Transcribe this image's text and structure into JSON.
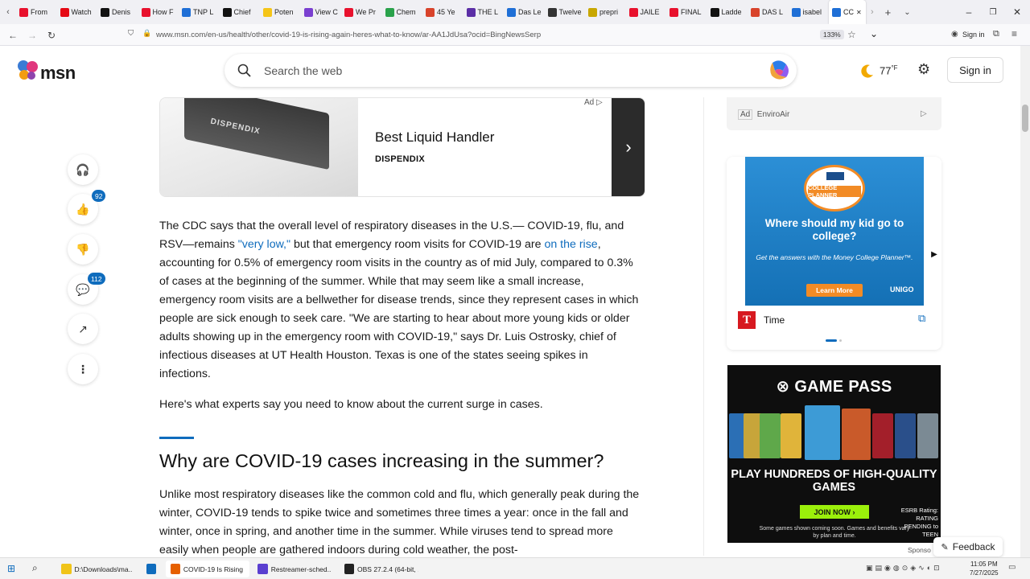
{
  "browser": {
    "tabs": [
      {
        "label": "From",
        "color": "#e8112d"
      },
      {
        "label": "Watch",
        "color": "#e50914"
      },
      {
        "label": "Denis",
        "color": "#111111"
      },
      {
        "label": "How F",
        "color": "#e8112d"
      },
      {
        "label": "TNP L",
        "color": "#1f6fd6"
      },
      {
        "label": "Chief",
        "color": "#111111"
      },
      {
        "label": "Poten",
        "color": "#f5c518"
      },
      {
        "label": "View C",
        "color": "#7a3fd0"
      },
      {
        "label": "We Pr",
        "color": "#e8112d"
      },
      {
        "label": "Chem",
        "color": "#2aa24b"
      },
      {
        "label": "45 Ye",
        "color": "#d8432b"
      },
      {
        "label": "THE L",
        "color": "#5b2ea6"
      },
      {
        "label": "Das Le",
        "color": "#1f6fd6"
      },
      {
        "label": "Twelve",
        "color": "#333333"
      },
      {
        "label": "prepri",
        "color": "#c8a700"
      },
      {
        "label": "JAILE",
        "color": "#e8112d"
      },
      {
        "label": "FINAL",
        "color": "#e8112d"
      },
      {
        "label": "Ladde",
        "color": "#111111"
      },
      {
        "label": "DAS L",
        "color": "#d8432b"
      },
      {
        "label": "isabel",
        "color": "#1f6fd6"
      },
      {
        "label": "CC",
        "color": "#1f6fd6",
        "active": true
      }
    ],
    "url": "www.msn.com/en-us/health/other/covid-19-is-rising-again-heres-what-to-know/ar-AA1JdUsa?ocid=BingNewsSerp",
    "zoom": "133%",
    "signin": "Sign in"
  },
  "header": {
    "logo": "msn",
    "search_placeholder": "Search the web",
    "temperature": "77",
    "temp_unit": "°F",
    "signin": "Sign in"
  },
  "rail": {
    "likes": "92",
    "comments": "112"
  },
  "ad": {
    "title": "Best Liquid Handler",
    "sponsor": "DISPENDIX",
    "tag": "Ad",
    "image_text": "DISPENDIX"
  },
  "article": {
    "p1_a": "The CDC says that the overall level of respiratory diseases in the U.S.— COVID-19, flu, and RSV—remains ",
    "p1_link1": "\"very low,\"",
    "p1_b": " but that emergency room visits for COVID-19 are ",
    "p1_link2": "on the rise",
    "p1_c": ", accounting for 0.5% of emergency room visits in the country as of mid July, compared to 0.3% of cases at the beginning of the summer. While that may seem like a small increase, emergency room visits are a bellwether for disease trends, since they represent cases in which people are sick enough to seek care. \"We are starting to hear about more young kids or older adults showing up in the emergency room with COVID-19,\" says Dr. Luis Ostrosky, chief of infectious diseases at UT Health Houston. Texas is one of the states seeing spikes in infections.",
    "p2": "Here's what experts say you need to know about the current surge in cases.",
    "h2": "Why are COVID-19 cases increasing in the summer?",
    "p3": "Unlike most respiratory diseases like the common cold and flu, which generally peak during the winter, COVID-19 tends to spike twice and sometimes three times a year: once in the fall and winter, once in spring, and another time in the summer. While viruses tend to spread more easily when people are gathered indoors during cold weather, the post-"
  },
  "right": {
    "ad1_tag": "Ad",
    "ad1_name": "EnviroAir",
    "college": {
      "banner": "COLLEGE PLANNER",
      "question": "Where should my kid go to college?",
      "sub": "Get the answers with the Money College Planner™.",
      "button": "Learn More",
      "powered": "UNIGO"
    },
    "source": "Time",
    "source_logo": "T",
    "gamepass": {
      "logo": "GAME PASS",
      "headline": "PLAY HUNDREDS OF HIGH-QUALITY GAMES",
      "button": "JOIN NOW ›",
      "fine": "Some games shown coming soon. Games and benefits vary by plan and time.",
      "esrb": "ESRB Rating: RATING PENDING to TEEN"
    },
    "sponsored": "Sponso",
    "feedback": "Feedback"
  },
  "taskbar": {
    "items": [
      {
        "label": "D:\\Downloads\\ma...",
        "color": "#f0c419"
      },
      {
        "label": "",
        "color": "#0f6cbd"
      },
      {
        "label": "COVID-19 Is Rising ...",
        "color": "#e66000",
        "active": true
      },
      {
        "label": "Restreamer-sched...",
        "color": "#5a3fd0"
      },
      {
        "label": "OBS 27.2.4 (64-bit, ...",
        "color": "#222222"
      }
    ],
    "time": "11:05 PM",
    "date": "7/27/2025"
  }
}
